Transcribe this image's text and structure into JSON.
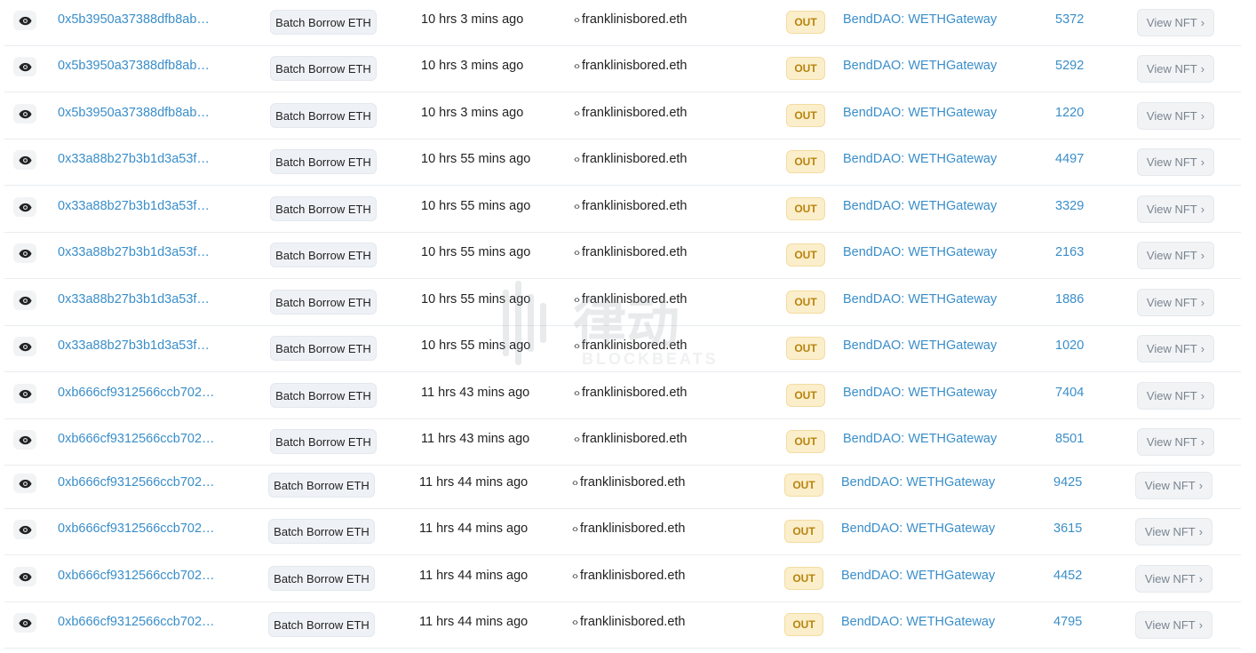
{
  "rows": [
    {
      "hash": "0x5b3950a37388dfb8ab…",
      "method": "Batch Borrow ETH",
      "age": "10 hrs 3 mins ago",
      "from": "franklinisbored.eth",
      "direction": "OUT",
      "to": "BendDAO: WETHGateway",
      "token_id": "5372",
      "action": "View NFT"
    },
    {
      "hash": "0x5b3950a37388dfb8ab…",
      "method": "Batch Borrow ETH",
      "age": "10 hrs 3 mins ago",
      "from": "franklinisbored.eth",
      "direction": "OUT",
      "to": "BendDAO: WETHGateway",
      "token_id": "5292",
      "action": "View NFT"
    },
    {
      "hash": "0x5b3950a37388dfb8ab…",
      "method": "Batch Borrow ETH",
      "age": "10 hrs 3 mins ago",
      "from": "franklinisbored.eth",
      "direction": "OUT",
      "to": "BendDAO: WETHGateway",
      "token_id": "1220",
      "action": "View NFT"
    },
    {
      "hash": "0x33a88b27b3b1d3a53f…",
      "method": "Batch Borrow ETH",
      "age": "10 hrs 55 mins ago",
      "from": "franklinisbored.eth",
      "direction": "OUT",
      "to": "BendDAO: WETHGateway",
      "token_id": "4497",
      "action": "View NFT"
    },
    {
      "hash": "0x33a88b27b3b1d3a53f…",
      "method": "Batch Borrow ETH",
      "age": "10 hrs 55 mins ago",
      "from": "franklinisbored.eth",
      "direction": "OUT",
      "to": "BendDAO: WETHGateway",
      "token_id": "3329",
      "action": "View NFT"
    },
    {
      "hash": "0x33a88b27b3b1d3a53f…",
      "method": "Batch Borrow ETH",
      "age": "10 hrs 55 mins ago",
      "from": "franklinisbored.eth",
      "direction": "OUT",
      "to": "BendDAO: WETHGateway",
      "token_id": "2163",
      "action": "View NFT"
    },
    {
      "hash": "0x33a88b27b3b1d3a53f…",
      "method": "Batch Borrow ETH",
      "age": "10 hrs 55 mins ago",
      "from": "franklinisbored.eth",
      "direction": "OUT",
      "to": "BendDAO: WETHGateway",
      "token_id": "1886",
      "action": "View NFT"
    },
    {
      "hash": "0x33a88b27b3b1d3a53f…",
      "method": "Batch Borrow ETH",
      "age": "10 hrs 55 mins ago",
      "from": "franklinisbored.eth",
      "direction": "OUT",
      "to": "BendDAO: WETHGateway",
      "token_id": "1020",
      "action": "View NFT"
    },
    {
      "hash": "0xb666cf9312566ccb702…",
      "method": "Batch Borrow ETH",
      "age": "11 hrs 43 mins ago",
      "from": "franklinisbored.eth",
      "direction": "OUT",
      "to": "BendDAO: WETHGateway",
      "token_id": "7404",
      "action": "View NFT"
    },
    {
      "hash": "0xb666cf9312566ccb702…",
      "method": "Batch Borrow ETH",
      "age": "11 hrs 43 mins ago",
      "from": "franklinisbored.eth",
      "direction": "OUT",
      "to": "BendDAO: WETHGateway",
      "token_id": "8501",
      "action": "View NFT"
    },
    {
      "hash": "0xb666cf9312566ccb702…",
      "method": "Batch Borrow ETH",
      "age": "11 hrs 44 mins ago",
      "from": "franklinisbored.eth",
      "direction": "OUT",
      "to": "BendDAO: WETHGateway",
      "token_id": "9425",
      "action": "View NFT"
    },
    {
      "hash": "0xb666cf9312566ccb702…",
      "method": "Batch Borrow ETH",
      "age": "11 hrs 44 mins ago",
      "from": "franklinisbored.eth",
      "direction": "OUT",
      "to": "BendDAO: WETHGateway",
      "token_id": "3615",
      "action": "View NFT"
    },
    {
      "hash": "0xb666cf9312566ccb702…",
      "method": "Batch Borrow ETH",
      "age": "11 hrs 44 mins ago",
      "from": "franklinisbored.eth",
      "direction": "OUT",
      "to": "BendDAO: WETHGateway",
      "token_id": "4452",
      "action": "View NFT"
    },
    {
      "hash": "0xb666cf9312566ccb702…",
      "method": "Batch Borrow ETH",
      "age": "11 hrs 44 mins ago",
      "from": "franklinisbored.eth",
      "direction": "OUT",
      "to": "BendDAO: WETHGateway",
      "token_id": "4795",
      "action": "View NFT"
    }
  ],
  "icons": {
    "preview": "eye-icon",
    "from_prefix": "code-icon",
    "action_suffix": "chevron-right-icon"
  },
  "colors": {
    "link": "#3a8ec9",
    "out_badge_bg": "#fbeecb",
    "out_badge_text": "#b7840d",
    "method_bg": "#eef2f6",
    "button_bg": "#f1f3f5"
  },
  "watermark": {
    "cn": "律动",
    "en": "BLOCKBEATS"
  }
}
